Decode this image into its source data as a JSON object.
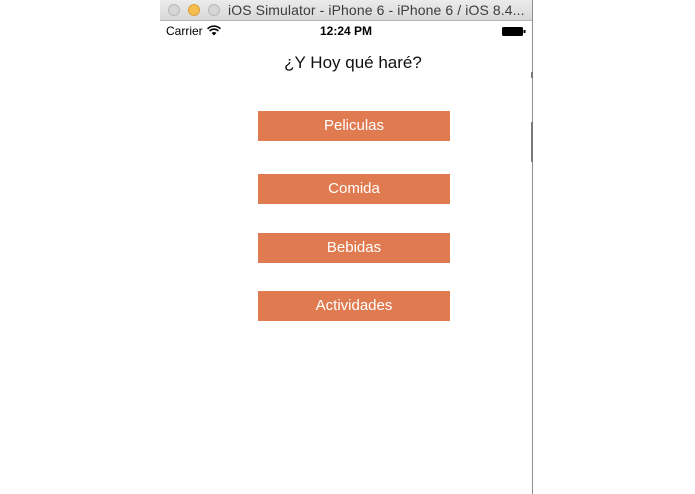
{
  "window": {
    "title": "iOS Simulator - iPhone 6 - iPhone 6 / iOS 8.4..."
  },
  "statusbar": {
    "carrier": "Carrier",
    "time": "12:24 PM",
    "wifi_icon": "wifi-icon",
    "battery_icon": "battery-icon"
  },
  "app": {
    "title": "¿Y Hoy qué haré?",
    "buttons": [
      {
        "label": "Peliculas"
      },
      {
        "label": "Comida"
      },
      {
        "label": "Bebidas"
      },
      {
        "label": "Actividades"
      }
    ],
    "button_color": "#e07b51",
    "button_text_color": "#ffffff"
  }
}
